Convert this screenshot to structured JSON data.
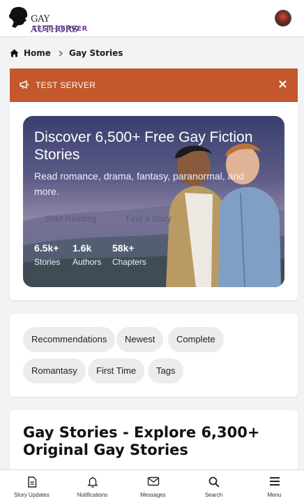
{
  "header": {
    "brand_top": "GAY AUTHORS",
    "brand_bottom": "TEST SERVER",
    "logo_icon": "head-silhouette-icon",
    "avatar_icon": "user-avatar"
  },
  "breadcrumb": {
    "home": "Home",
    "current": "Gay Stories"
  },
  "alert": {
    "text": "TEST SERVER",
    "close": "×",
    "color": "#c3582c"
  },
  "hero": {
    "title": "Discover 6,500+ Free Gay Fiction Stories",
    "subtitle": "Read romance, drama, fantasy, paranormal, and more.",
    "btn_start": "Start Reading",
    "btn_find": "Find a Story",
    "stats": [
      {
        "num": "6.5k+",
        "label": "Stories"
      },
      {
        "num": "1.6k",
        "label": "Authors"
      },
      {
        "num": "58k+",
        "label": "Chapters"
      }
    ]
  },
  "tags": [
    "Recommendations",
    "Newest",
    "Complete",
    "Romantasy",
    "First Time",
    "Tags"
  ],
  "main": {
    "title": "Gay Stories - Explore 6,300+ Original Gay Stories"
  },
  "bottom_nav": [
    {
      "label": "Story Updates",
      "icon": "document-icon"
    },
    {
      "label": "Notifications",
      "icon": "bell-icon"
    },
    {
      "label": "Messages",
      "icon": "envelope-icon"
    },
    {
      "label": "Search",
      "icon": "search-icon"
    },
    {
      "label": "Menu",
      "icon": "menu-icon"
    }
  ],
  "colors": {
    "accent": "#c3582c",
    "background": "#f2f3f5"
  }
}
